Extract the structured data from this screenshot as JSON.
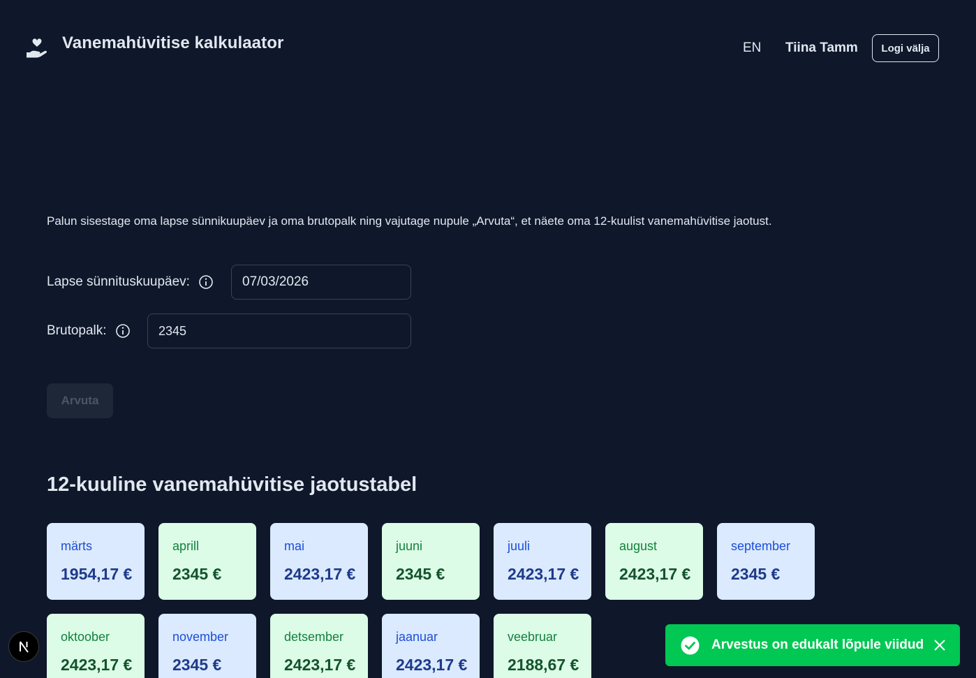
{
  "header": {
    "title": "Vanemahüvitise kalkulaator",
    "language": "EN",
    "user_name": "Tiina Tamm",
    "logout_label": "Logi välja",
    "logo_icon": "hand-heart-icon"
  },
  "intro": {
    "text": "Palun sisestage oma lapse sünnikuupäev ja oma brutopalk ning vajutage nupule „Arvuta“, et näete oma 12-kuulist vanemahüvitise jaotust."
  },
  "form": {
    "birthdate_label": "Lapse sünnituskuupäev:",
    "birthdate_value": "07/03/2026",
    "salary_label": "Brutopalk:",
    "salary_value": "2345",
    "calculate_label": "Arvuta",
    "info_icon": "info-circle-icon"
  },
  "table": {
    "title": "12-kuuline vanemahüvitise jaotustabel",
    "months": [
      {
        "month": "märts",
        "amount": "1954,17 €",
        "color": "blue"
      },
      {
        "month": "aprill",
        "amount": "2345 €",
        "color": "green"
      },
      {
        "month": "mai",
        "amount": "2423,17 €",
        "color": "blue"
      },
      {
        "month": "juuni",
        "amount": "2345 €",
        "color": "green"
      },
      {
        "month": "juuli",
        "amount": "2423,17 €",
        "color": "blue"
      },
      {
        "month": "august",
        "amount": "2423,17 €",
        "color": "green"
      },
      {
        "month": "september",
        "amount": "2345 €",
        "color": "blue"
      },
      {
        "month": "oktoober",
        "amount": "2423,17 €",
        "color": "green"
      },
      {
        "month": "november",
        "amount": "2345 €",
        "color": "blue"
      },
      {
        "month": "detsember",
        "amount": "2423,17 €",
        "color": "green"
      },
      {
        "month": "jaanuar",
        "amount": "2423,17 €",
        "color": "blue"
      },
      {
        "month": "veebruar",
        "amount": "2188,67 €",
        "color": "green"
      }
    ]
  },
  "toast": {
    "message": "Arvestus on edukalt lõpule viidud",
    "icon": "check-circle-icon",
    "close_icon": "close-icon"
  },
  "colors": {
    "background": "#0f172a",
    "card_blue": "#dbeafe",
    "card_green": "#dcfce7",
    "toast": "#00c853"
  }
}
